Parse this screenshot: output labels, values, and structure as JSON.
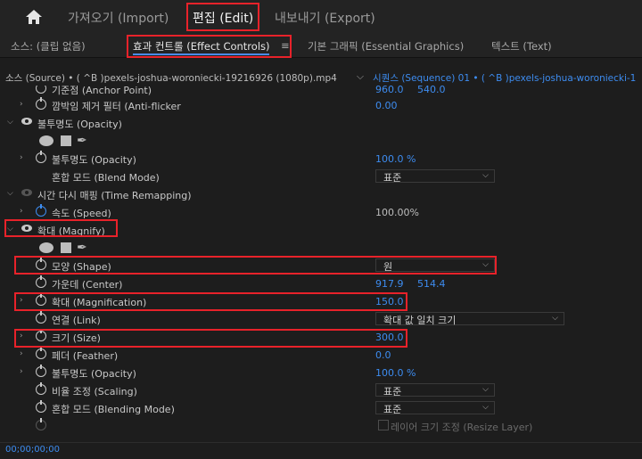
{
  "topbar": {
    "tabs": [
      {
        "label": "가져오기 (Import)"
      },
      {
        "label": "편집 (Edit)"
      },
      {
        "label": "내보내기 (Export)"
      }
    ]
  },
  "panel_tabs": [
    {
      "label": "소스: (클립 없음)"
    },
    {
      "label": "효과 컨트롤 (Effect Controls)"
    },
    {
      "label": "≡"
    },
    {
      "label": "기본 그래픽 (Essential Graphics)"
    },
    {
      "label": "텍스트 (Text)"
    }
  ],
  "source_bar": {
    "source": "소스 (Source) • ( ^B )pexels-joshua-woroniecki-19216926 (1080p).mp4",
    "sequence": "시퀀스 (Sequence) 01 • ( ^B )pexels-joshua-woroniecki-1"
  },
  "rows": {
    "anchor_label": "기준점 (Anchor Point)",
    "anchor_x": "960.0",
    "anchor_y": "540.0",
    "antiflicker_label": "깜박임 제거 필터 (Anti-flicker",
    "antiflicker_value": "0.00",
    "opacity_header": "불투명도 (Opacity)",
    "opacity_label": "불투명도 (Opacity)",
    "opacity_value": "100.0 %",
    "blend_label": "혼합 모드 (Blend Mode)",
    "blend_value": "표준",
    "time_remap_header": "시간 다시 매핑 (Time Remapping)",
    "speed_label": "속도 (Speed)",
    "speed_value": "100.00%",
    "magnify_header": "확대 (Magnify)",
    "shape_label": "모양 (Shape)",
    "shape_value": "원",
    "center_label": "가운데 (Center)",
    "center_x": "917.9",
    "center_y": "514.4",
    "magnification_label": "확대 (Magnification)",
    "magnification_value": "150.0",
    "link_label": "연결 (Link)",
    "link_value": "확대 값 일치 크기",
    "size_label": "크기 (Size)",
    "size_value": "300.0",
    "feather_label": "페더 (Feather)",
    "feather_value": "0.0",
    "m_opacity_label": "불투명도 (Opacity)",
    "m_opacity_value": "100.0 %",
    "scaling_label": "비율 조정 (Scaling)",
    "scaling_value": "표준",
    "m_blend_label": "혼합 모드 (Blending Mode)",
    "m_blend_value": "표준",
    "resize_layer_label": "레이어 크기 조정 (Resize Layer)"
  },
  "timecode": "00;00;00;00",
  "colors": {
    "accent": "#3d8cf0",
    "highlight": "#e8222a"
  },
  "icons": [
    "home-icon",
    "stopwatch-icon",
    "eye-icon",
    "ellipse-mask-icon",
    "rectangle-mask-icon",
    "pen-mask-icon",
    "chevron-down-icon"
  ]
}
